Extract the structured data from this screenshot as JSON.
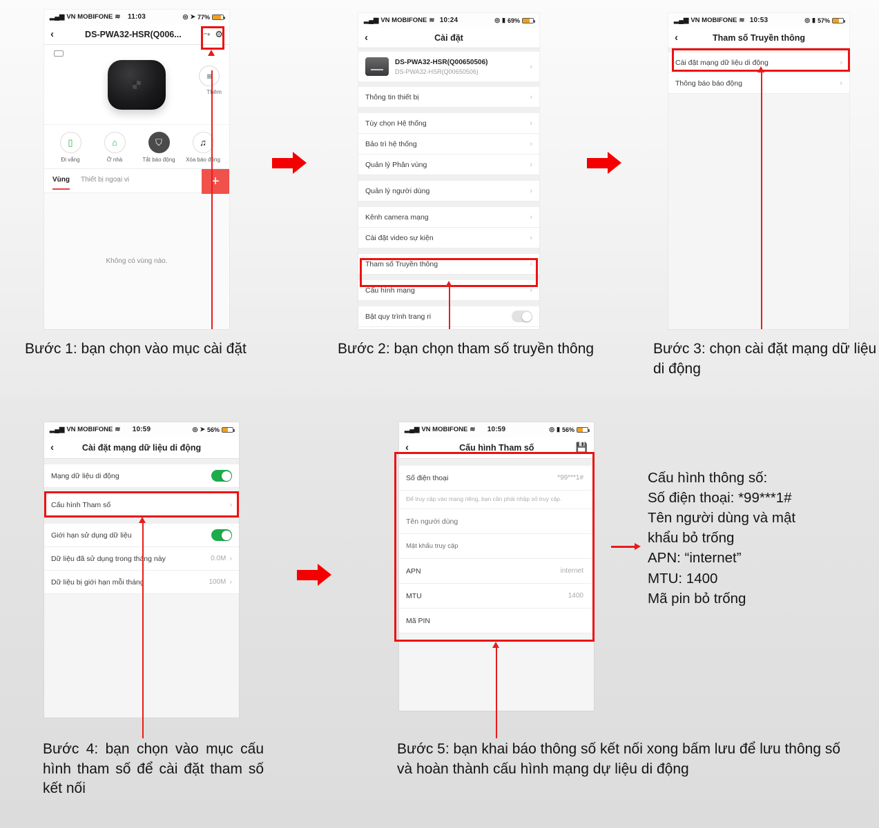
{
  "meta": {
    "accent_red": "#e81c1c",
    "arrow_red": "#f40000",
    "toggle_green": "#1eab4b"
  },
  "phone1": {
    "status": {
      "carrier": "VN MOBIFONE",
      "time": "11:03",
      "battery": "77%"
    },
    "nav": {
      "back": "‹",
      "title": "DS-PWA32-HSR(Q006...",
      "share_icon": "share-icon",
      "gear_icon": "gear-icon"
    },
    "quick_actions": [
      {
        "label": "Đi vắng",
        "icon": "away-icon"
      },
      {
        "label": "Ở nhà",
        "icon": "home-icon"
      },
      {
        "label": "Tắt báo động",
        "icon": "disarm-icon"
      },
      {
        "label": "Xóa báo động",
        "icon": "clear-alarm-icon"
      }
    ],
    "add_label": "Thêm",
    "tabs": [
      {
        "label": "Vùng",
        "active": true
      },
      {
        "label": "Thiết bị ngoại vi",
        "active": false
      }
    ],
    "plus_label": "+",
    "empty_text": "Không có vùng nào."
  },
  "phone2": {
    "status": {
      "carrier": "VN MOBIFONE",
      "time": "10:24",
      "battery": "69%"
    },
    "nav": {
      "back": "‹",
      "title": "Cài đặt"
    },
    "device": {
      "name": "DS-PWA32-HSR(Q00650506)",
      "sub": "DS-PWA32-HSR(Q00650506)"
    },
    "items": [
      "Thông tin thiết bị",
      "Tùy chọn Hệ thống",
      "Bảo trì hệ thống",
      "Quản lý Phân vùng",
      "Quản lý người dùng",
      "Kênh camera mạng",
      "Cài đặt video sự kiện",
      "Tham số Truyền thông",
      "Cấu hình mạng",
      "Bật quy trình trang ri"
    ],
    "highlight_item": "Tham số Truyền thông"
  },
  "phone3": {
    "status": {
      "carrier": "VN MOBIFONE",
      "time": "10:53",
      "battery": "57%"
    },
    "nav": {
      "back": "‹",
      "title": "Tham số Truyền thông"
    },
    "items": [
      "Cài đặt mạng dữ liệu di động",
      "Thông báo báo động"
    ],
    "highlight_item": "Cài đặt mạng dữ liệu di động"
  },
  "phone4": {
    "status": {
      "carrier": "VN MOBIFONE",
      "time": "10:59",
      "battery": "56%"
    },
    "nav": {
      "back": "‹",
      "title": "Cài đặt mạng dữ liệu di động"
    },
    "rows": [
      {
        "label": "Mạng dữ liệu di động",
        "type": "toggle",
        "on": true
      },
      {
        "label": "Cấu hình Tham số",
        "type": "chevron",
        "value": ""
      },
      {
        "label": "Giới hạn sử dụng dữ liệu",
        "type": "toggle",
        "on": true
      },
      {
        "label": "Dữ liệu đã sử dụng trong tháng này",
        "type": "chevron",
        "value": "0.0M"
      },
      {
        "label": "Dữ liệu bị giới hạn mỗi tháng",
        "type": "chevron",
        "value": "100M"
      }
    ],
    "highlight_item": "Cấu hình Tham số"
  },
  "phone5": {
    "status": {
      "carrier": "VN MOBIFONE",
      "time": "10:59",
      "battery": "56%"
    },
    "nav": {
      "back": "‹",
      "title": "Cấu hình Tham số",
      "save_icon": "save-disk-icon"
    },
    "rows": [
      {
        "label": "Số điện thoại",
        "value": "*99***1#"
      },
      {
        "label": "Tên người dùng",
        "value": ""
      },
      {
        "label": "Mật khẩu truy cập",
        "value": ""
      },
      {
        "label": "APN",
        "value": "internet"
      },
      {
        "label": "MTU",
        "value": "1400"
      },
      {
        "label": "Mã PIN",
        "value": ""
      }
    ],
    "hint": "Để truy cập vào mạng riêng, bạn cần phải nhập số truy cập."
  },
  "captions": {
    "step1": "Bước 1: bạn chọn vào mục cài đặt",
    "step2": "Bước 2: bạn chọn tham số truyền thông",
    "step3": "Bước 3: chọn cài đặt mạng dữ liệu di động",
    "step4": "Bước 4: bạn chọn vào mục cấu hình tham số để cài đặt tham số kết nối",
    "step5": "Bước 5: bạn khai báo thông số kết nối xong bấm lưu để lưu thông số và hoàn thành cấu hình mạng dự liệu di động"
  },
  "side_note": {
    "line1": "Cấu hình thông số:",
    "line2": "Số điện thoại: *99***1#",
    "line3": "Tên người dùng và mật",
    "line4": "khẩu bỏ trống",
    "line5": "APN: “internet”",
    "line6": "MTU: 1400",
    "line7": "Mã pin bỏ trống"
  }
}
